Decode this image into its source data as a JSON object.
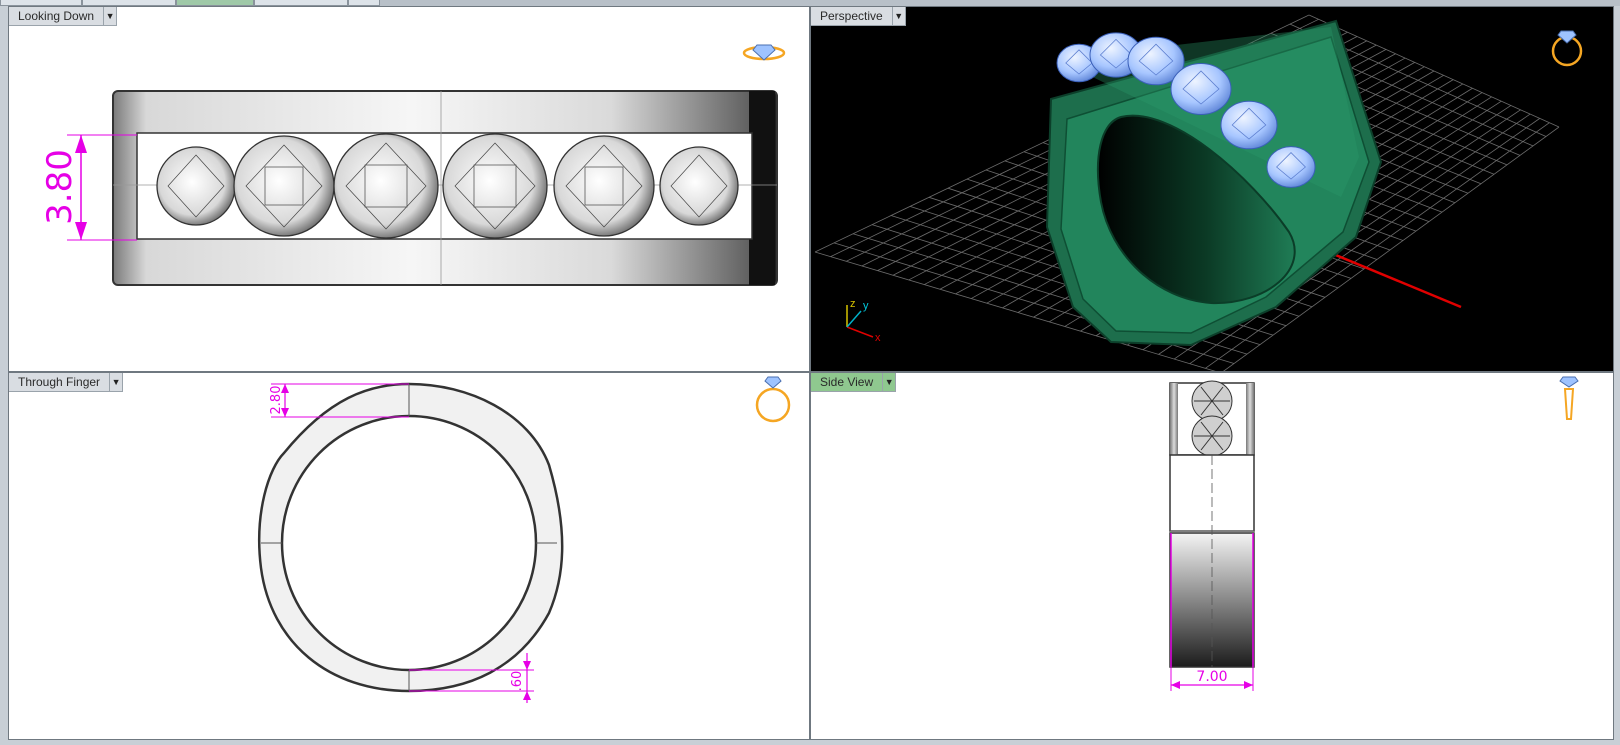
{
  "viewports": {
    "top_left": {
      "label": "Looking Down",
      "dim_value": "3.80"
    },
    "top_right": {
      "label": "Perspective",
      "axis_x": "x",
      "axis_y": "y",
      "axis_z": "z"
    },
    "bottom_left": {
      "label": "Through Finger",
      "dim_top": "2.80",
      "dim_bottom": ".60"
    },
    "bottom_right": {
      "label": "Side View",
      "dim_value": "7.00"
    }
  },
  "colors": {
    "dimension": "#e600e6",
    "ring_green": "#1e7a55",
    "gem_blue": "#9ec3ff",
    "icon_orange": "#f5a623",
    "active_tab": "#8fc88f"
  },
  "icons": [
    "gem-ring-icon",
    "dropdown-arrow-icon"
  ]
}
